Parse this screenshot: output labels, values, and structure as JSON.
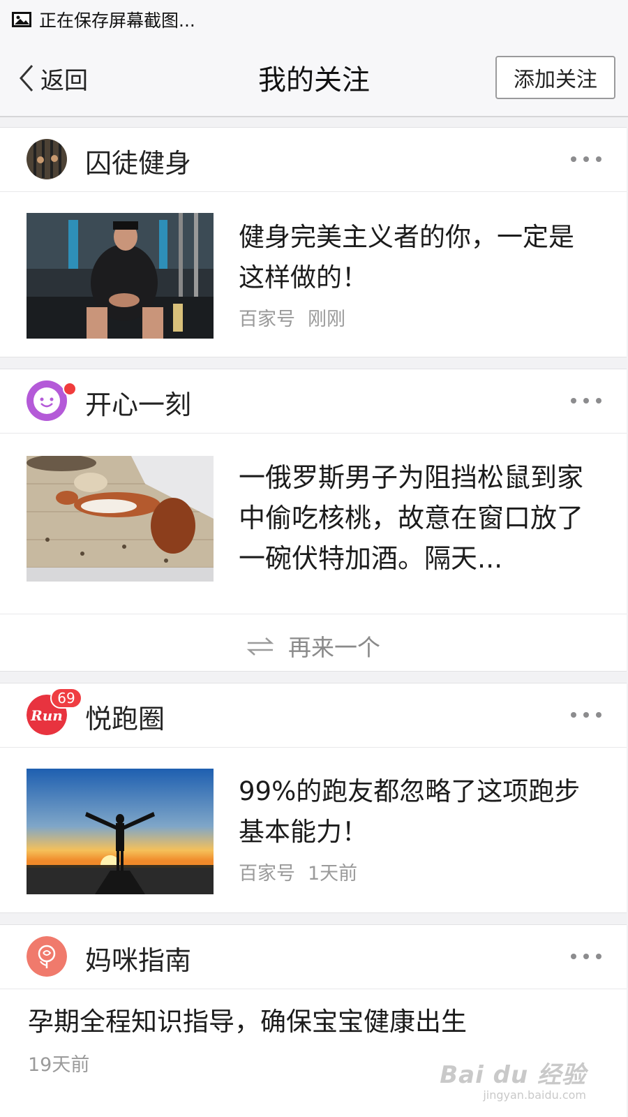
{
  "status_bar": {
    "icon": "image-icon",
    "text": "正在保存屏幕截图..."
  },
  "nav": {
    "back_label": "返回",
    "title": "我的关注",
    "add_button": "添加关注"
  },
  "feed": [
    {
      "account": "囚徒健身",
      "avatar_icon": "prison-bars-avatar",
      "article": {
        "title": "健身完美主义者的你，一定是这样做的！",
        "source": "百家号",
        "time": "刚刚"
      }
    },
    {
      "account": "开心一刻",
      "avatar_icon": "smile-avatar",
      "has_dot": true,
      "article": {
        "title": "一俄罗斯男子为阻挡松鼠到家中偷吃核桃，故意在窗口放了一碗伏特加酒。隔天..."
      },
      "more_label": "再来一个"
    },
    {
      "account": "悦跑圈",
      "avatar_icon": "run-logo-avatar",
      "avatar_text": "Run",
      "badge_count": "69",
      "article": {
        "title": "99%的跑友都忽略了这项跑步基本能力！",
        "source": "百家号",
        "time": "1天前"
      }
    },
    {
      "account": "妈咪指南",
      "avatar_icon": "rose-avatar",
      "article": {
        "title": "孕期全程知识指导，确保宝宝健康出生",
        "time": "19天前"
      }
    }
  ],
  "watermark": {
    "logo": "Bai du 经验",
    "url": "jingyan.baidu.com"
  },
  "colors": {
    "badge": "#ef3d42",
    "smile_avatar": "#b45ad8",
    "run_avatar": "#e8333f",
    "rose_avatar": "#f07a6c"
  }
}
